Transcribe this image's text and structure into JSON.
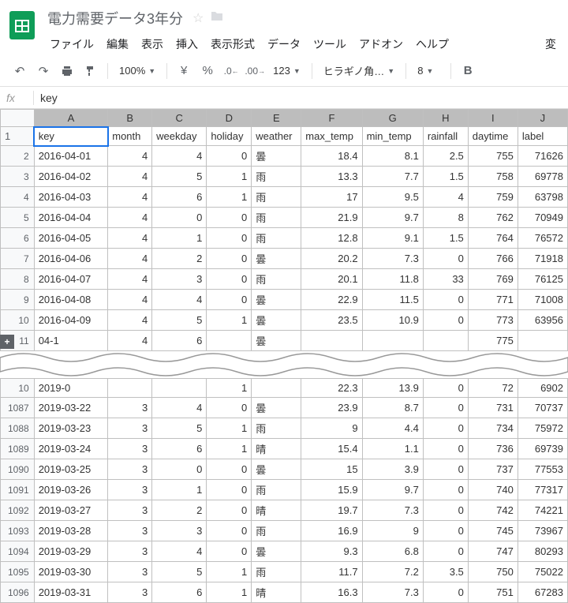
{
  "header": {
    "doc_title": "電力需要データ3年分"
  },
  "menubar": {
    "file": "ファイル",
    "edit": "編集",
    "view": "表示",
    "insert": "挿入",
    "format": "表示形式",
    "data": "データ",
    "tools": "ツール",
    "addons": "アドオン",
    "help": "ヘルプ",
    "extra": "変"
  },
  "toolbar": {
    "zoom": "100%",
    "currency": "¥",
    "percent": "%",
    "dec_dec": ".0",
    "inc_dec": ".00",
    "num_format": "123",
    "font": "ヒラギノ角…",
    "font_size": "8",
    "bold": "B"
  },
  "formula_bar": {
    "fx": "fx",
    "value": "key"
  },
  "columns": [
    "A",
    "B",
    "C",
    "D",
    "E",
    "F",
    "G",
    "H",
    "I",
    "J"
  ],
  "header_row": {
    "rownum": "1",
    "cells": [
      "key",
      "month",
      "weekday",
      "holiday",
      "weather",
      "max_temp",
      "min_temp",
      "rainfall",
      "daytime",
      "label"
    ]
  },
  "rows_top": [
    {
      "n": "2",
      "c": [
        "2016-04-01",
        "4",
        "4",
        "0",
        "曇",
        "18.4",
        "8.1",
        "2.5",
        "755",
        "71626"
      ]
    },
    {
      "n": "3",
      "c": [
        "2016-04-02",
        "4",
        "5",
        "1",
        "雨",
        "13.3",
        "7.7",
        "1.5",
        "758",
        "69778"
      ]
    },
    {
      "n": "4",
      "c": [
        "2016-04-03",
        "4",
        "6",
        "1",
        "雨",
        "17",
        "9.5",
        "4",
        "759",
        "63798"
      ]
    },
    {
      "n": "5",
      "c": [
        "2016-04-04",
        "4",
        "0",
        "0",
        "雨",
        "21.9",
        "9.7",
        "8",
        "762",
        "70949"
      ]
    },
    {
      "n": "6",
      "c": [
        "2016-04-05",
        "4",
        "1",
        "0",
        "雨",
        "12.8",
        "9.1",
        "1.5",
        "764",
        "76572"
      ]
    },
    {
      "n": "7",
      "c": [
        "2016-04-06",
        "4",
        "2",
        "0",
        "曇",
        "20.2",
        "7.3",
        "0",
        "766",
        "71918"
      ]
    },
    {
      "n": "8",
      "c": [
        "2016-04-07",
        "4",
        "3",
        "0",
        "雨",
        "20.1",
        "11.8",
        "33",
        "769",
        "76125"
      ]
    },
    {
      "n": "9",
      "c": [
        "2016-04-08",
        "4",
        "4",
        "0",
        "曇",
        "22.9",
        "11.5",
        "0",
        "771",
        "71008"
      ]
    },
    {
      "n": "10",
      "c": [
        "2016-04-09",
        "4",
        "5",
        "1",
        "曇",
        "23.5",
        "10.9",
        "0",
        "773",
        "63956"
      ]
    }
  ],
  "row_partial_top": {
    "n": "11",
    "c": [
      "04-1",
      "4",
      "6",
      "",
      "曇",
      "",
      "",
      "",
      "775",
      ""
    ]
  },
  "row_partial_bottom": {
    "n": "10",
    "c": [
      "2019-0",
      "",
      "",
      "1",
      "",
      "22.3",
      "13.9",
      "0",
      "72",
      "6902"
    ]
  },
  "rows_bottom": [
    {
      "n": "1087",
      "c": [
        "2019-03-22",
        "3",
        "4",
        "0",
        "曇",
        "23.9",
        "8.7",
        "0",
        "731",
        "70737"
      ]
    },
    {
      "n": "1088",
      "c": [
        "2019-03-23",
        "3",
        "5",
        "1",
        "雨",
        "9",
        "4.4",
        "0",
        "734",
        "75972"
      ]
    },
    {
      "n": "1089",
      "c": [
        "2019-03-24",
        "3",
        "6",
        "1",
        "晴",
        "15.4",
        "1.1",
        "0",
        "736",
        "69739"
      ]
    },
    {
      "n": "1090",
      "c": [
        "2019-03-25",
        "3",
        "0",
        "0",
        "曇",
        "15",
        "3.9",
        "0",
        "737",
        "77553"
      ]
    },
    {
      "n": "1091",
      "c": [
        "2019-03-26",
        "3",
        "1",
        "0",
        "雨",
        "15.9",
        "9.7",
        "0",
        "740",
        "77317"
      ]
    },
    {
      "n": "1092",
      "c": [
        "2019-03-27",
        "3",
        "2",
        "0",
        "晴",
        "19.7",
        "7.3",
        "0",
        "742",
        "74221"
      ]
    },
    {
      "n": "1093",
      "c": [
        "2019-03-28",
        "3",
        "3",
        "0",
        "雨",
        "16.9",
        "9",
        "0",
        "745",
        "73967"
      ]
    },
    {
      "n": "1094",
      "c": [
        "2019-03-29",
        "3",
        "4",
        "0",
        "曇",
        "9.3",
        "6.8",
        "0",
        "747",
        "80293"
      ]
    },
    {
      "n": "1095",
      "c": [
        "2019-03-30",
        "3",
        "5",
        "1",
        "雨",
        "11.7",
        "7.2",
        "3.5",
        "750",
        "75022"
      ]
    },
    {
      "n": "1096",
      "c": [
        "2019-03-31",
        "3",
        "6",
        "1",
        "晴",
        "16.3",
        "7.3",
        "0",
        "751",
        "67283"
      ]
    }
  ],
  "chart_data": {
    "type": "table",
    "columns": [
      "key",
      "month",
      "weekday",
      "holiday",
      "weather",
      "max_temp",
      "min_temp",
      "rainfall",
      "daytime",
      "label"
    ],
    "rows_visible_top": [
      [
        "2016-04-01",
        4,
        4,
        0,
        "曇",
        18.4,
        8.1,
        2.5,
        755,
        71626
      ],
      [
        "2016-04-02",
        4,
        5,
        1,
        "雨",
        13.3,
        7.7,
        1.5,
        758,
        69778
      ],
      [
        "2016-04-03",
        4,
        6,
        1,
        "雨",
        17,
        9.5,
        4,
        759,
        63798
      ],
      [
        "2016-04-04",
        4,
        0,
        0,
        "雨",
        21.9,
        9.7,
        8,
        762,
        70949
      ],
      [
        "2016-04-05",
        4,
        1,
        0,
        "雨",
        12.8,
        9.1,
        1.5,
        764,
        76572
      ],
      [
        "2016-04-06",
        4,
        2,
        0,
        "曇",
        20.2,
        7.3,
        0,
        766,
        71918
      ],
      [
        "2016-04-07",
        4,
        3,
        0,
        "雨",
        20.1,
        11.8,
        33,
        769,
        76125
      ],
      [
        "2016-04-08",
        4,
        4,
        0,
        "曇",
        22.9,
        11.5,
        0,
        771,
        71008
      ],
      [
        "2016-04-09",
        4,
        5,
        1,
        "曇",
        23.5,
        10.9,
        0,
        773,
        63956
      ]
    ],
    "rows_visible_bottom": [
      [
        "2019-03-22",
        3,
        4,
        0,
        "曇",
        23.9,
        8.7,
        0,
        731,
        70737
      ],
      [
        "2019-03-23",
        3,
        5,
        1,
        "雨",
        9,
        4.4,
        0,
        734,
        75972
      ],
      [
        "2019-03-24",
        3,
        6,
        1,
        "晴",
        15.4,
        1.1,
        0,
        736,
        69739
      ],
      [
        "2019-03-25",
        3,
        0,
        0,
        "曇",
        15,
        3.9,
        0,
        737,
        77553
      ],
      [
        "2019-03-26",
        3,
        1,
        0,
        "雨",
        15.9,
        9.7,
        0,
        740,
        77317
      ],
      [
        "2019-03-27",
        3,
        2,
        0,
        "晴",
        19.7,
        7.3,
        0,
        742,
        74221
      ],
      [
        "2019-03-28",
        3,
        3,
        0,
        "雨",
        16.9,
        9,
        0,
        745,
        73967
      ],
      [
        "2019-03-29",
        3,
        4,
        0,
        "曇",
        9.3,
        6.8,
        0,
        747,
        80293
      ],
      [
        "2019-03-30",
        3,
        5,
        1,
        "雨",
        11.7,
        7.2,
        3.5,
        750,
        75022
      ],
      [
        "2019-03-31",
        3,
        6,
        1,
        "晴",
        16.3,
        7.3,
        0,
        751,
        67283
      ]
    ]
  }
}
